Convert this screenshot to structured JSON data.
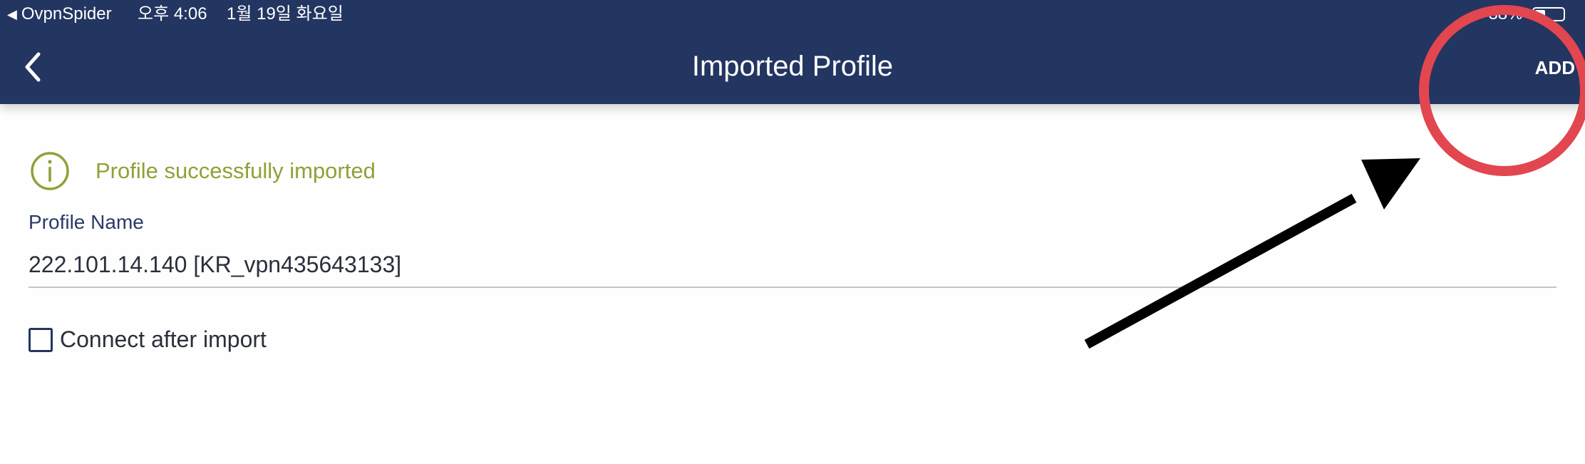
{
  "status_bar": {
    "back_app": "OvpnSpider",
    "time": "오후 4:06",
    "date": "1월 19일 화요일",
    "battery": "38%"
  },
  "nav": {
    "title": "Imported Profile",
    "add_label": "ADD"
  },
  "content": {
    "info_message": "Profile successfully imported",
    "profile_name_label": "Profile Name",
    "profile_name_value": "222.101.14.140 [KR_vpn435643133]",
    "connect_after_import_label": "Connect after import",
    "connect_after_import_checked": false
  },
  "colors": {
    "nav_background": "#233561",
    "success_text": "#8ea236",
    "annotation_circle": "#e2464f",
    "annotation_arrow": "#000000"
  },
  "icons": {
    "back": "chevron-left-icon",
    "info": "info-circle-icon",
    "location": "location-arrow-icon",
    "battery": "battery-icon"
  }
}
